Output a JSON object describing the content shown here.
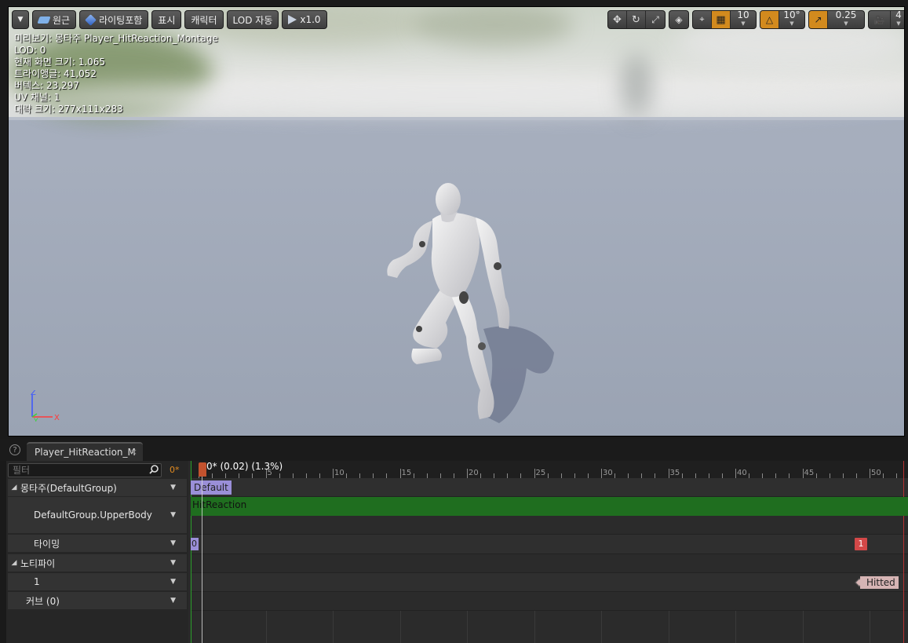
{
  "viewport": {
    "toolbar_left": [
      {
        "id": "menu",
        "label": "",
        "icon": "chevron-down-icon"
      },
      {
        "id": "perspective",
        "label": "원근",
        "icon": "perspective-icon"
      },
      {
        "id": "lighting",
        "label": "라이팅포함",
        "icon": "lit-sphere-icon"
      },
      {
        "id": "show",
        "label": "표시",
        "icon": ""
      },
      {
        "id": "character",
        "label": "캐릭터",
        "icon": ""
      },
      {
        "id": "lod",
        "label": "LOD 자동",
        "icon": ""
      },
      {
        "id": "speed",
        "label": "x1.0",
        "icon": "play-speed-icon"
      }
    ],
    "grid_snap_value": "10",
    "rotation_snap_value": "10°",
    "scale_snap_value": "0.25",
    "camera_speed_value": "4",
    "stats": [
      "미리보기: 몽타주 Player_HitReaction_Montage",
      "LOD: 0",
      "현재 화면 크기: 1.065",
      "트라이앵글: 41,052",
      "버텍스: 23,297",
      "UV 채널: 1",
      "대략 크기: 277x111x283"
    ],
    "axis": {
      "x": "X",
      "y": "Y",
      "z": "Z"
    },
    "colors": {
      "accent_orange": "#d28a1e"
    }
  },
  "tab": {
    "title": "Player_HitReaction_M",
    "close": "×"
  },
  "tracks": {
    "filter_placeholder": "필터",
    "frame_readout": "0*",
    "rows": [
      {
        "label": "몽타주(DefaultGroup)",
        "expandable": true
      },
      {
        "label": "DefaultGroup.UpperBody",
        "expandable": false
      },
      {
        "label": "타이밍",
        "expandable": false
      },
      {
        "label": "노티파이",
        "expandable": true
      },
      {
        "label": "1",
        "expandable": false
      },
      {
        "label": "커브 (0)",
        "expandable": false
      }
    ]
  },
  "timeline": {
    "scrub_text": "0* (0.02) (1.3%)",
    "tick_labels": [
      "5",
      "10",
      "15",
      "20",
      "25",
      "30",
      "35",
      "40",
      "45",
      "50"
    ],
    "slot_label": "Default",
    "segment_label": "HitReaction",
    "timing_start": "0",
    "timing_end": "1",
    "notify_label": "Hitted",
    "colors": {
      "segment": "#1f6e1f",
      "timing": "#d34848",
      "notify": "#d6b4b4",
      "slot": "#9a8fd8"
    }
  }
}
